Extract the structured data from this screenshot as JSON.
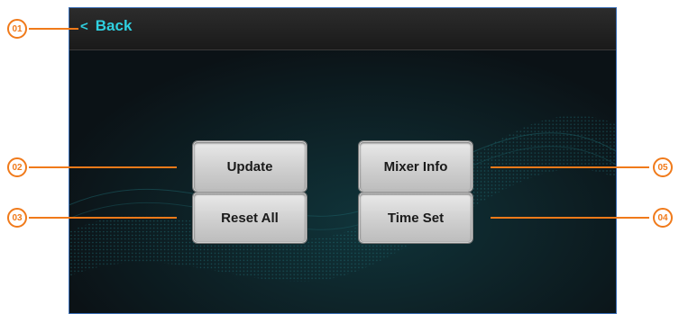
{
  "screen": {
    "back_label": "Back",
    "buttons": {
      "update": "Update",
      "mixer_info": "Mixer Info",
      "reset_all": "Reset All",
      "time_set": "Time Set"
    }
  },
  "callouts": {
    "c01": "01",
    "c02": "02",
    "c03": "03",
    "c04": "04",
    "c05": "05"
  },
  "colors": {
    "accent": "#2fd0e0",
    "callout": "#f07a1a",
    "frame": "#3b6fb6"
  },
  "icons": {
    "back": "chevron-left-icon"
  }
}
